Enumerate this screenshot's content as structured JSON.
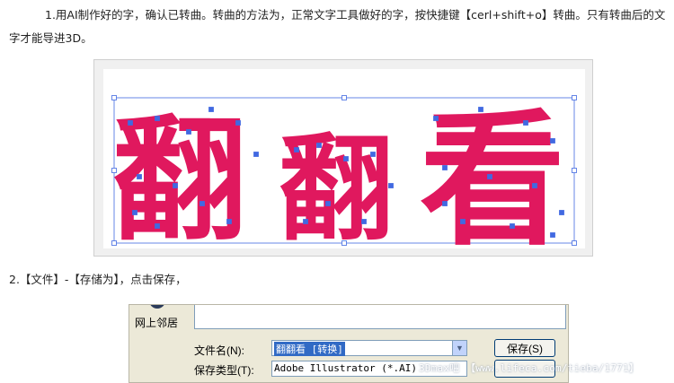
{
  "step1": {
    "text": "1.用AI制作好的字，确认已转曲。转曲的方法为，正常文字工具做好的字，按快捷键【cerl+shift+o】转曲。只有转曲后的文字才能导进3D。"
  },
  "artwork": {
    "characters": [
      "翻",
      "翻",
      "看"
    ],
    "fill_color": "#e0185e",
    "anchor_color": "#4169e1"
  },
  "step2": {
    "text": "2.【文件】-【存储为】，点击保存，"
  },
  "save_dialog": {
    "places_label": "网上邻居",
    "filename_label": "文件名(N):",
    "filename_value": "翻翻看 [转换]",
    "filetype_label": "保存类型(T):",
    "filetype_value": "Adobe Illustrator (*.AI)",
    "save_button": "保存(S)",
    "cancel_button": ""
  },
  "watermark": {
    "text": "3Dmax吧 【www.lifeca.com/tieba/1771】"
  }
}
